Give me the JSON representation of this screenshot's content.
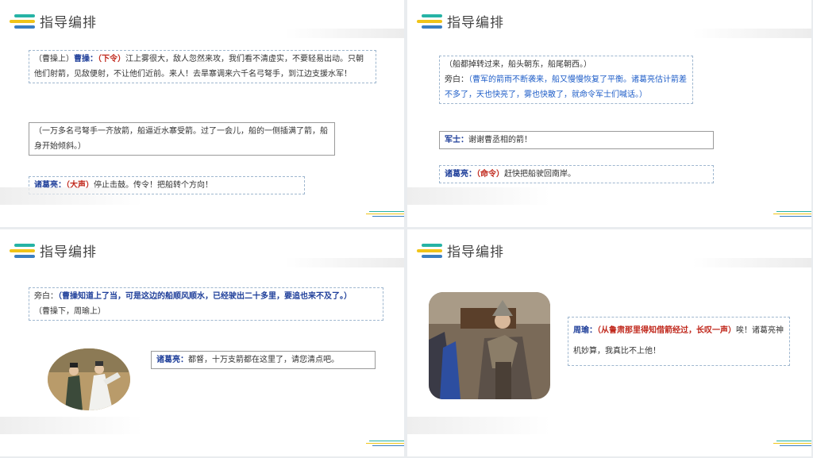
{
  "slides": [
    {
      "title": "指导编排",
      "box1": {
        "pre": "（曹操上）",
        "speaker": "曹操：",
        "tone": "（下令）",
        "text": "江上雾很大，敌人忽然来攻，我们看不清虚实，不要轻易出动。只朝他们射箭，见敌便射，不让他们近前。来人！去旱寨调来六千名弓弩手，到江边支援水军！"
      },
      "box2": {
        "text": "（一万多名弓弩手一齐放箭，船逼近水寨受箭。过了一会儿，船的一侧插满了箭，船身开始倾斜。）"
      },
      "box3": {
        "speaker": "诸葛亮：",
        "tone": "（大声）",
        "text": "停止击鼓。传令！把船转个方向！"
      }
    },
    {
      "title": "指导编排",
      "box1": {
        "line1": "（船都掉转过来，船头朝东，船尾朝西。）",
        "label": "旁白：",
        "narration": "（曹军的箭雨不断袭来，船又慢慢恢复了平衡。诸葛亮估计箭差不多了，天也快亮了，雾也快散了，就命令军士们喊话。）"
      },
      "box2": {
        "speaker": "军士：",
        "text": "谢谢曹丞相的箭！"
      },
      "box3": {
        "speaker": "诸葛亮：",
        "tone": "（命令）",
        "text": "赶快把船驶回南岸。"
      }
    },
    {
      "title": "指导编排",
      "box1": {
        "label": "旁白：",
        "narration": "（曹操知道上了当，可是这边的船顺风顺水，已经驶出二十多里，要追也来不及了。）",
        "line2": "（曹操下，周瑜上）"
      },
      "box2": {
        "speaker": "诸葛亮：",
        "text": "都督，十万支箭都在这里了，请您清点吧。"
      }
    },
    {
      "title": "指导编排",
      "box1": {
        "speaker": "周瑜：",
        "tone": "（从鲁肃那里得知借箭经过，长叹一声）",
        "text": "唉！诸葛亮神机妙算，我真比不上他！"
      }
    }
  ],
  "colors": {
    "accent_teal": "#26b3a5",
    "accent_yellow": "#f0c419",
    "accent_blue": "#3a7fc2",
    "speaker_blue": "#1f3f9a",
    "tone_red": "#c0281c"
  },
  "icons": [
    "logo-stripes-icon"
  ]
}
